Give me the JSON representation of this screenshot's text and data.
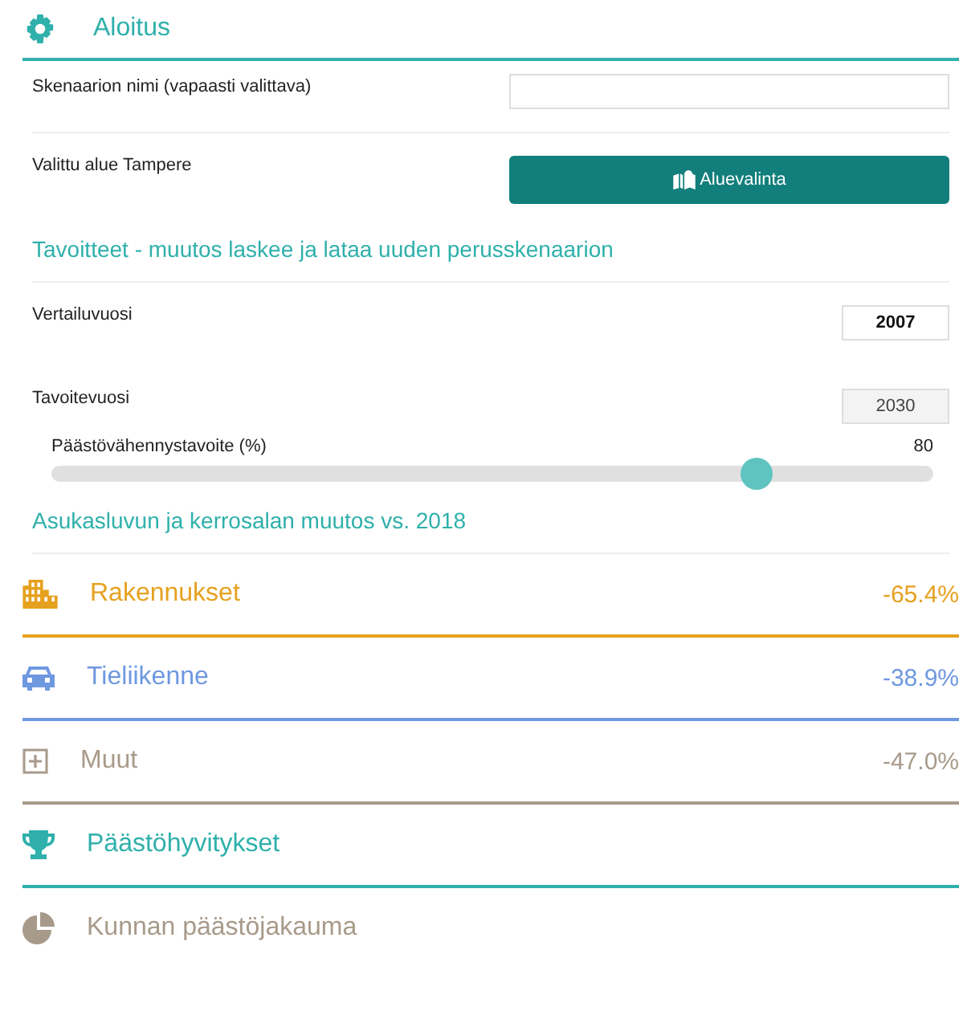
{
  "header": {
    "title": "Aloitus"
  },
  "scenario_name": {
    "label": "Skenaarion nimi (vapaasti valittava)"
  },
  "area": {
    "label": "Valittu alue Tampere",
    "button": "Aluevalinta"
  },
  "targets_heading": "Tavoitteet - muutos laskee ja lataa uuden perusskenaarion",
  "year_fields": [
    {
      "label": "Vertailuvuosi",
      "value": "2007",
      "disabled": false
    },
    {
      "label": "Tavoitevuosi",
      "value": "2030",
      "disabled": true
    }
  ],
  "slider": {
    "label": "Päästövähennystavoite (%)",
    "reading": "80",
    "level": 0.8
  },
  "population_heading": "Asukasluvun ja kerrosalan muutos vs. 2018",
  "sections": [
    {
      "kind": "buildings",
      "title": "Rakennukset",
      "value": "-65.4%",
      "color": "#e6a11f"
    },
    {
      "kind": "car",
      "title": "Tieliikenne",
      "value": "-38.9%",
      "color": "#6e98e0"
    },
    {
      "kind": "plus",
      "title": "Muut",
      "value": "-47.0%",
      "color": "#a89a8a"
    },
    {
      "kind": "trophy",
      "title": "Päästöhyvitykset",
      "color": "#2fb0ab"
    },
    {
      "kind": "pie",
      "title": "Kunnan päästöjakauma",
      "color": "#a89a8a"
    }
  ]
}
